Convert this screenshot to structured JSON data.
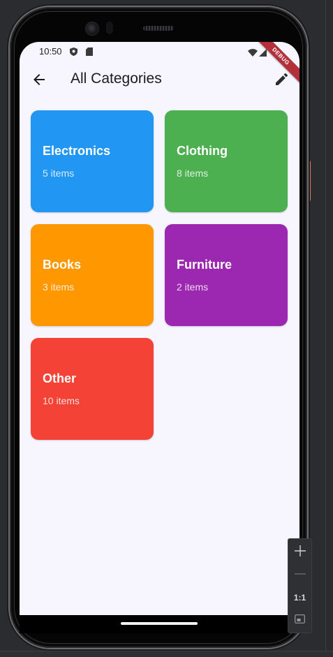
{
  "status_bar": {
    "time": "10:50",
    "icons": [
      "shield-icon",
      "sd-card-icon",
      "wifi-icon",
      "signal-icon"
    ],
    "debug_label": "DEBUG"
  },
  "app_bar": {
    "title": "All Categories",
    "back_icon": "arrow-back-icon",
    "edit_icon": "edit-pencil-icon"
  },
  "categories": [
    {
      "name": "Electronics",
      "count": "5 items",
      "color": "#2196f3"
    },
    {
      "name": "Clothing",
      "count": "8 items",
      "color": "#4caf50"
    },
    {
      "name": "Books",
      "count": "3 items",
      "color": "#ff9800"
    },
    {
      "name": "Furniture",
      "count": "2 items",
      "color": "#9c27b0"
    },
    {
      "name": "Other",
      "count": "10 items",
      "color": "#f44336"
    }
  ],
  "colors": {
    "background": "#f7f5fd",
    "title_text": "#1c1b1f",
    "debug_banner": "#b3303b"
  },
  "emulator_controls": {
    "zoom_in_icon": "plus-icon",
    "zoom_out_icon": "minus-icon",
    "actual_size_label": "1:1",
    "fit_screen_icon": "fit-screen-icon"
  }
}
